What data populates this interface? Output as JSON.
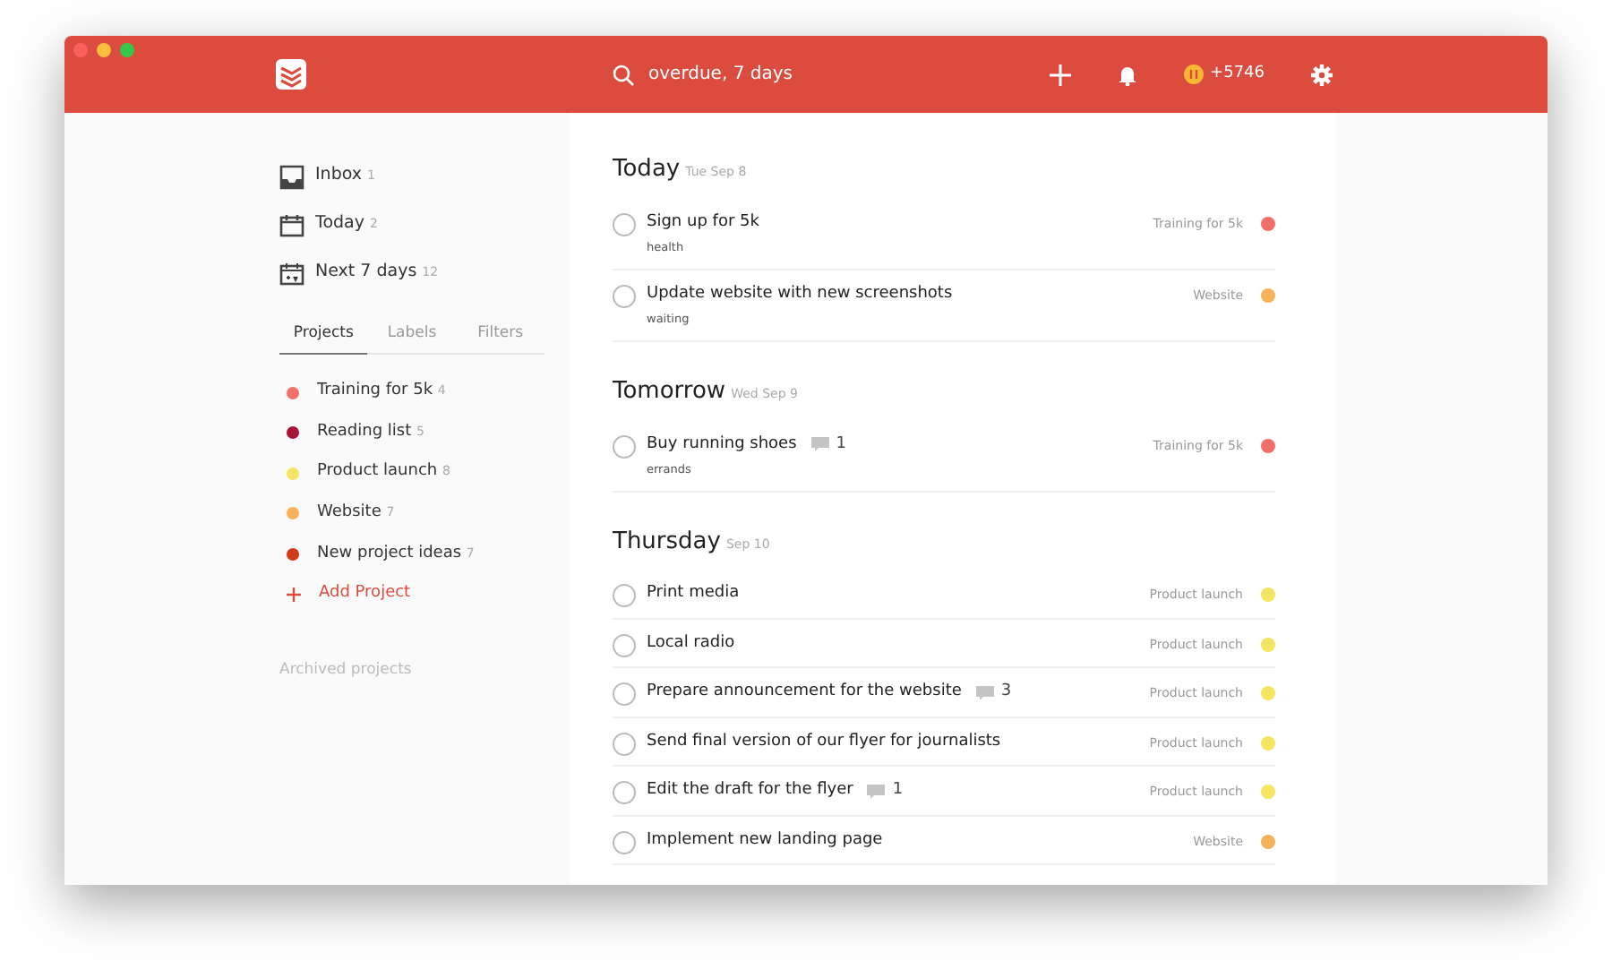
{
  "search": {
    "text": "overdue, 7 days"
  },
  "karma": {
    "text": "+5746"
  },
  "nav": [
    {
      "kind": "inbox",
      "label": "Inbox",
      "count": "1"
    },
    {
      "kind": "today",
      "label": "Today",
      "count": "2"
    },
    {
      "kind": "week",
      "label": "Next 7 days",
      "count": "12"
    }
  ],
  "tabs": [
    {
      "label": "Projects",
      "selected": true
    },
    {
      "label": "Labels",
      "selected": false
    },
    {
      "label": "Filters",
      "selected": false
    }
  ],
  "projects": [
    {
      "name": "Training for 5k",
      "count": "4",
      "color": "#f2706c"
    },
    {
      "name": "Reading list",
      "count": "5",
      "color": "#a8153b"
    },
    {
      "name": "Product launch",
      "count": "8",
      "color": "#f5e462"
    },
    {
      "name": "Website",
      "count": "7",
      "color": "#f5b25a"
    },
    {
      "name": "New project ideas",
      "count": "7",
      "color": "#d33a1c"
    }
  ],
  "add_project": "Add Project",
  "archived": "Archived projects",
  "days": [
    {
      "title": "Today",
      "date": "Tue Sep 8",
      "tasks": [
        {
          "name": "Sign up for 5k",
          "checked": false,
          "label": "health",
          "project": "Training for 5k",
          "color": "#f2706c"
        },
        {
          "name": "Update website with new screenshots",
          "checked": false,
          "label": "waiting",
          "project": "Website",
          "color": "#f5b25a"
        }
      ]
    },
    {
      "title": "Tomorrow",
      "date": "Wed Sep 9",
      "tasks": [
        {
          "name": "Buy running shoes",
          "checked": false,
          "comments": "1",
          "label": "errands",
          "project": "Training for 5k",
          "color": "#f2706c"
        }
      ]
    },
    {
      "title": "Thursday",
      "date": "Sep 10",
      "tasks": [
        {
          "name": "Print media",
          "checked": false,
          "project": "Product launch",
          "color": "#f5e462"
        },
        {
          "name": "Local radio",
          "checked": false,
          "project": "Product launch",
          "color": "#f5e462"
        },
        {
          "name": "Prepare announcement for the website",
          "checked": false,
          "comments": "3",
          "project": "Product launch",
          "color": "#f5e462"
        },
        {
          "name": "Send final version of our flyer for journalists",
          "checked": false,
          "project": "Product launch",
          "color": "#f5e462"
        },
        {
          "name": "Edit the draft for the flyer",
          "checked": false,
          "comments": "1",
          "project": "Product launch",
          "color": "#f5e462"
        },
        {
          "name": "Implement new landing page",
          "checked": false,
          "project": "Website",
          "color": "#f5b25a"
        }
      ]
    }
  ]
}
